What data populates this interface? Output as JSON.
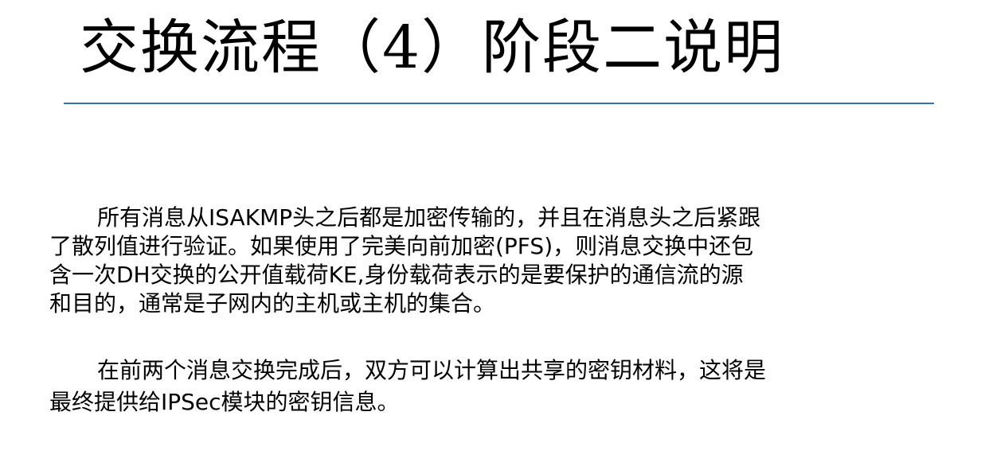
{
  "slide": {
    "title": "交换流程（4）阶段二说明",
    "accent_color": "#2e75b6",
    "paragraphs": [
      {
        "lines": [
          "所有消息从ISAKMP头之后都是加密传输的，并且在消息头之后紧跟",
          "了散列值进行验证。如果使用了完美向前加密(PFS)，则消息交换中还包",
          "含一次DH交换的公开值载荷KE,身份载荷表示的是要保护的通信流的源",
          "和目的，通常是子网内的主机或主机的集合。"
        ]
      },
      {
        "lines": [
          "在前两个消息交换完成后，双方可以计算出共享的密钥材料，这将是",
          "最终提供给IPSec模块的密钥信息。"
        ]
      }
    ]
  }
}
